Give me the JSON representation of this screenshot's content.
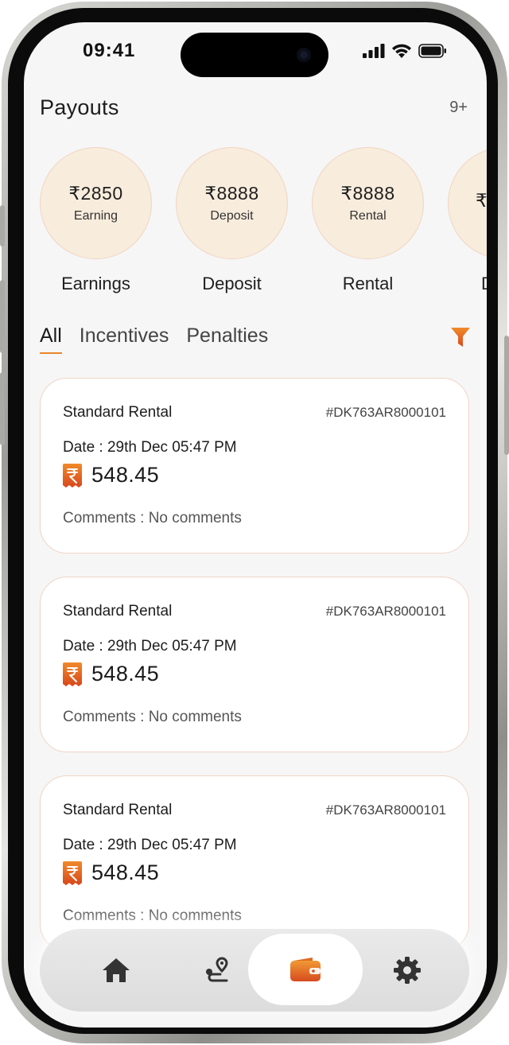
{
  "status_bar": {
    "time": "09:41"
  },
  "header": {
    "title": "Payouts",
    "notification_count": "9+"
  },
  "summary": [
    {
      "amount": "₹2850",
      "sub": "Earning",
      "label": "Earnings"
    },
    {
      "amount": "₹8888",
      "sub": "Deposit",
      "label": "Deposit"
    },
    {
      "amount": "₹8888",
      "sub": "Rental",
      "label": "Rental"
    },
    {
      "amount": "₹",
      "sub": "",
      "label": "D"
    }
  ],
  "tabs": [
    {
      "label": "All",
      "active": true
    },
    {
      "label": "Incentives",
      "active": false
    },
    {
      "label": "Penalties",
      "active": false
    }
  ],
  "payouts": [
    {
      "title": "Standard Rental",
      "id": "#DK763AR8000101",
      "date": "Date :  29th Dec  05:47 PM",
      "amount": "548.45",
      "comments": "Comments :  No comments"
    },
    {
      "title": "Standard Rental",
      "id": "#DK763AR8000101",
      "date": "Date :  29th Dec  05:47 PM",
      "amount": "548.45",
      "comments": "Comments :  No comments"
    },
    {
      "title": "Standard Rental",
      "id": "#DK763AR8000101",
      "date": "Date :  29th Dec  05:47 PM",
      "amount": "548.45",
      "comments": "Comments :  No comments"
    }
  ],
  "bottom_nav": [
    {
      "icon": "home-icon",
      "active": false
    },
    {
      "icon": "route-icon",
      "active": false
    },
    {
      "icon": "wallet-icon",
      "active": true
    },
    {
      "icon": "gear-icon",
      "active": false
    }
  ],
  "colors": {
    "accent": "#e8872a",
    "accent_dark": "#d9531e",
    "circle_bg": "#f8ecdc",
    "card_border": "#f0d4c6"
  }
}
